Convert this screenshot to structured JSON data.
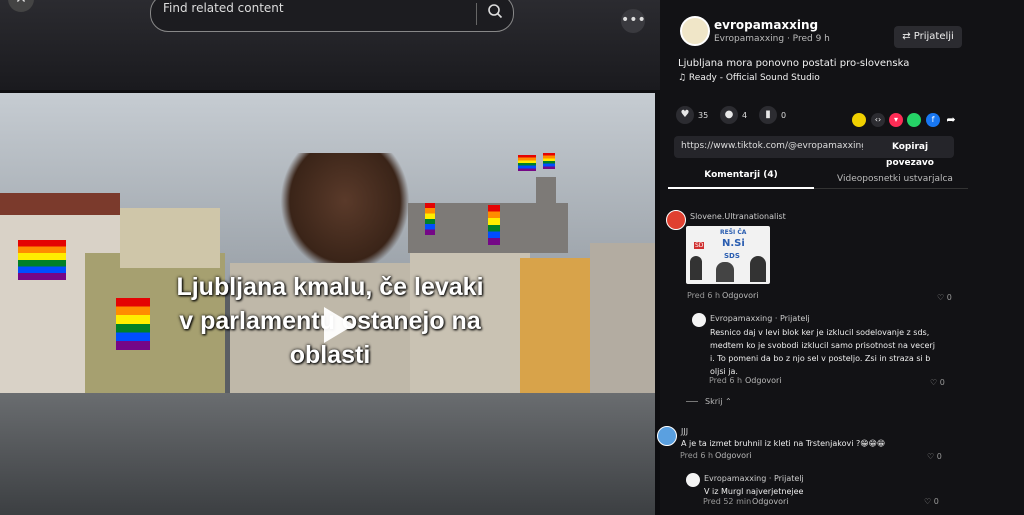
{
  "search": {
    "placeholder": "Find related content"
  },
  "top": {
    "close": "✕",
    "more": "•••"
  },
  "video": {
    "caption_line1": "Ljubljana kmalu, če levaki",
    "caption_line2": "v parlamentu ostanejo na",
    "caption_line3": "oblasti"
  },
  "post": {
    "username": "evropamaxxing",
    "subline": "Evropamaxxing · Pred 9 h",
    "friends_label": "⇄ Prijatelji",
    "description": "Ljubljana mora ponovno postati pro-slovenska",
    "music": "♫  Ready - Official Sound Studio",
    "likes": "35",
    "comments": "4",
    "saves": "0",
    "url": "https://www.tiktok.com/@evropamaxxing/vid...",
    "copy_label": "Kopiraj povezavo"
  },
  "tabs": {
    "comments": "Komentarji (4)",
    "creator_videos": "Videoposnetki ustvarjalca"
  },
  "meme": {
    "l1": "REŠI ČA",
    "l2": "N.Si",
    "l3": "SDS",
    "l4": "SD"
  },
  "comments": [
    {
      "name": "Slovene.Ultranationalist",
      "meta": "Pred 6 h",
      "reply": "Odgovori",
      "likes": "0"
    },
    {
      "name": "Evropamaxxing · Prijatelj",
      "text1": "Resnico daj v levi blok ker je izklucil sodelovanje z sds,",
      "text2": "medtem ko je svobodi izklucil samo prisotnost na vecerj",
      "text3": "i. To pomeni da bo z njo sel v posteljo. Zsi in straza si b",
      "text4": "oljsi ja.",
      "meta": "Pred 6 h",
      "reply": "Odgovori",
      "likes": "0"
    },
    {
      "hide": "Skrij ⌃"
    },
    {
      "name": "JJJ",
      "text1": "A je ta izmet bruhnil iz kleti na Trstenjakovi ?😁😁😁",
      "meta": "Pred 6 h",
      "reply": "Odgovori",
      "likes": "0"
    },
    {
      "name": "Evropamaxxing · Prijatelj",
      "text1": "V iz Murgl najverjetnejee",
      "meta": "Pred 52 min",
      "reply": "Odgovori",
      "likes": "0"
    }
  ],
  "colors": {
    "accent": "#fe2c55",
    "bg": "#121215"
  }
}
